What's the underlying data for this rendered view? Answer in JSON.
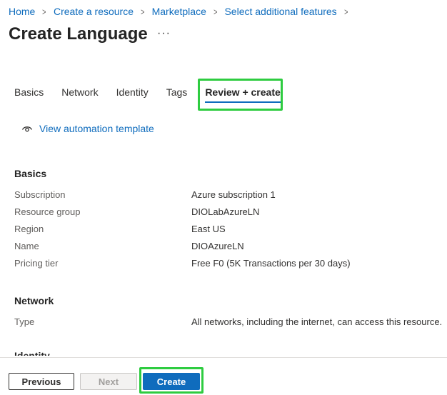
{
  "breadcrumb": [
    "Home",
    "Create a resource",
    "Marketplace",
    "Select additional features"
  ],
  "page": {
    "title": "Create Language",
    "more": "···"
  },
  "tabs": [
    "Basics",
    "Network",
    "Identity",
    "Tags",
    "Review + create"
  ],
  "automation_link": "View automation template",
  "basics": {
    "heading": "Basics",
    "rows": [
      {
        "label": "Subscription",
        "value": "Azure subscription 1"
      },
      {
        "label": "Resource group",
        "value": "DIOLabAzureLN"
      },
      {
        "label": "Region",
        "value": "East US"
      },
      {
        "label": "Name",
        "value": "DIOAzureLN"
      },
      {
        "label": "Pricing tier",
        "value": "Free F0 (5K Transactions per 30 days)"
      }
    ]
  },
  "network": {
    "heading": "Network",
    "rows": [
      {
        "label": "Type",
        "value": "All networks, including the internet, can access this resource."
      }
    ]
  },
  "identity": {
    "heading": "Identity"
  },
  "footer": {
    "previous": "Previous",
    "next": "Next",
    "create": "Create"
  },
  "colors": {
    "accent": "#0f6cbd",
    "highlight": "#2ecc40"
  }
}
